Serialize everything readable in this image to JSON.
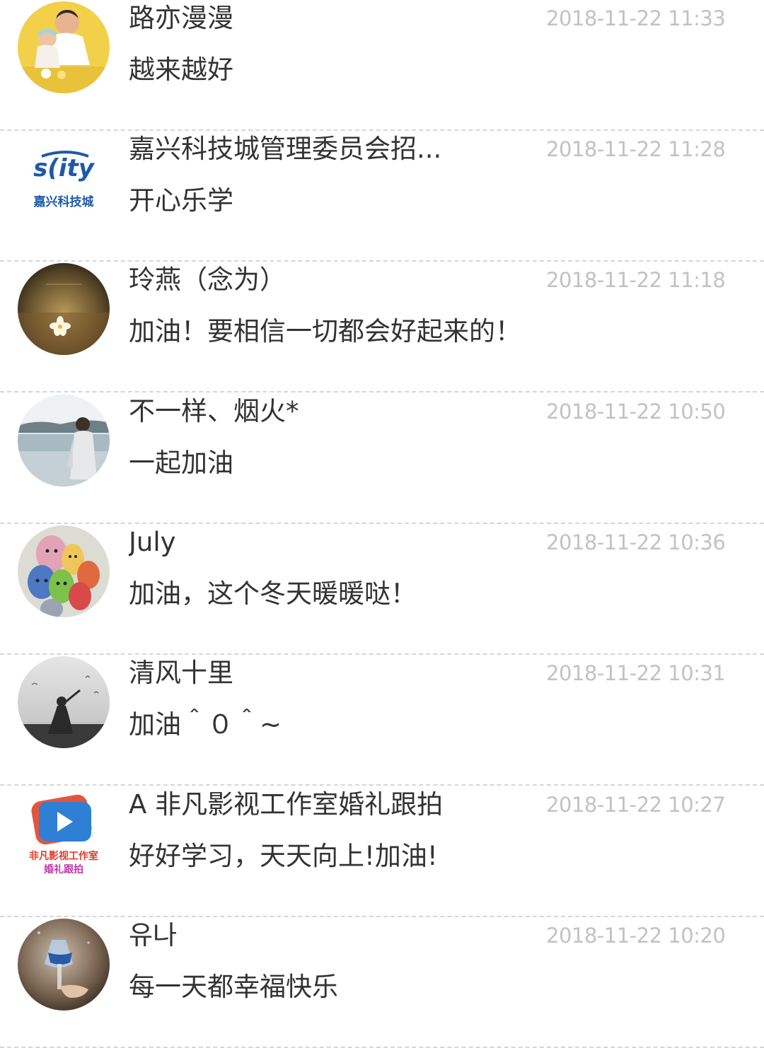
{
  "comments": [
    {
      "name": "路亦漫漫",
      "time": "2018-11-22 11:33",
      "text": "越来越好",
      "avatar_icon": "parent-with-baby-photo"
    },
    {
      "name": "嘉兴科技城管理委员会招...",
      "time": "2018-11-22 11:28",
      "text": "开心乐学",
      "avatar_icon": "scity-logo",
      "avatar_logo": {
        "brand": "s(ity",
        "subtitle": "嘉兴科技城"
      }
    },
    {
      "name": "玲燕（念为）",
      "time": "2018-11-22 11:18",
      "text": "加油！要相信一切都会好起来的！",
      "avatar_icon": "flower-on-table-photo"
    },
    {
      "name": "不一样、烟火*",
      "time": "2018-11-22 10:50",
      "text": "一起加油",
      "avatar_icon": "man-by-lake-photo"
    },
    {
      "name": "July",
      "time": "2018-11-22 10:36",
      "text": "加油，这个冬天暖暖哒！",
      "avatar_icon": "painted-pebbles-photo"
    },
    {
      "name": "清风十里",
      "time": "2018-11-22 10:31",
      "text": "加油＾０＾~",
      "avatar_icon": "figure-in-mist-photo"
    },
    {
      "name": "A 非凡影视工作室婚礼跟拍",
      "time": "2018-11-22 10:27",
      "text": "好好学习，天天向上!加油!",
      "avatar_icon": "video-play-logo",
      "avatar_logo": {
        "line1": "非凡影视工作室",
        "line2": "婚礼跟拍"
      }
    },
    {
      "name": "유나",
      "time": "2018-11-22 10:20",
      "text": "每一天都幸福快乐",
      "avatar_icon": "cocktail-glass-photo"
    }
  ],
  "colors": {
    "name": "#333333",
    "time": "#c2c2c2",
    "text": "#333333",
    "divider": "#d6d6d6"
  }
}
